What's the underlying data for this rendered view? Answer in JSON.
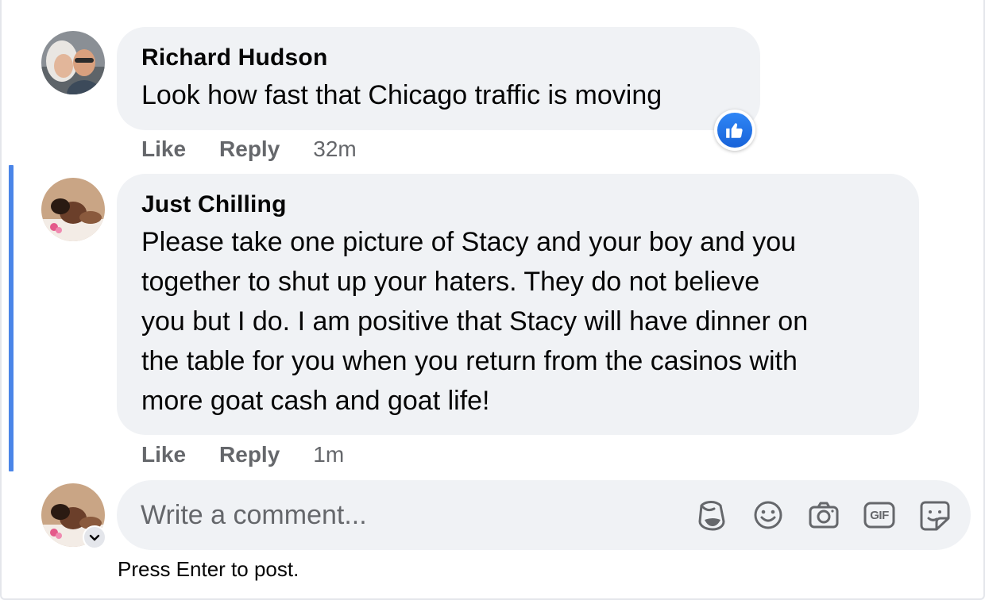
{
  "comments": [
    {
      "author": "Richard Hudson",
      "text": "Look how fast that Chicago traffic is moving",
      "actions": {
        "like": "Like",
        "reply": "Reply",
        "time": "32m"
      },
      "reaction": "like-icon"
    },
    {
      "author": "Just Chilling",
      "lines": [
        "Please take one picture of Stacy and your boy and you",
        "together to shut up your haters. They do not believe",
        "you but I do. I am positive that Stacy will have dinner on",
        "the table for you when you return from the casinos with",
        "more goat cash and goat life!"
      ],
      "actions": {
        "like": "Like",
        "reply": "Reply",
        "time": "1m"
      }
    }
  ],
  "composer": {
    "placeholder": "Write a comment...",
    "tools": [
      "avatar-sticker-icon",
      "emoji-icon",
      "camera-icon",
      "gif-icon",
      "sticker-icon"
    ],
    "gif_label": "GIF",
    "hint": "Press Enter to post."
  },
  "colors": {
    "thread_line": "#4a85e8",
    "bubble": "#f0f2f5",
    "like_blue": "#1877f2",
    "muted": "#65676b"
  }
}
